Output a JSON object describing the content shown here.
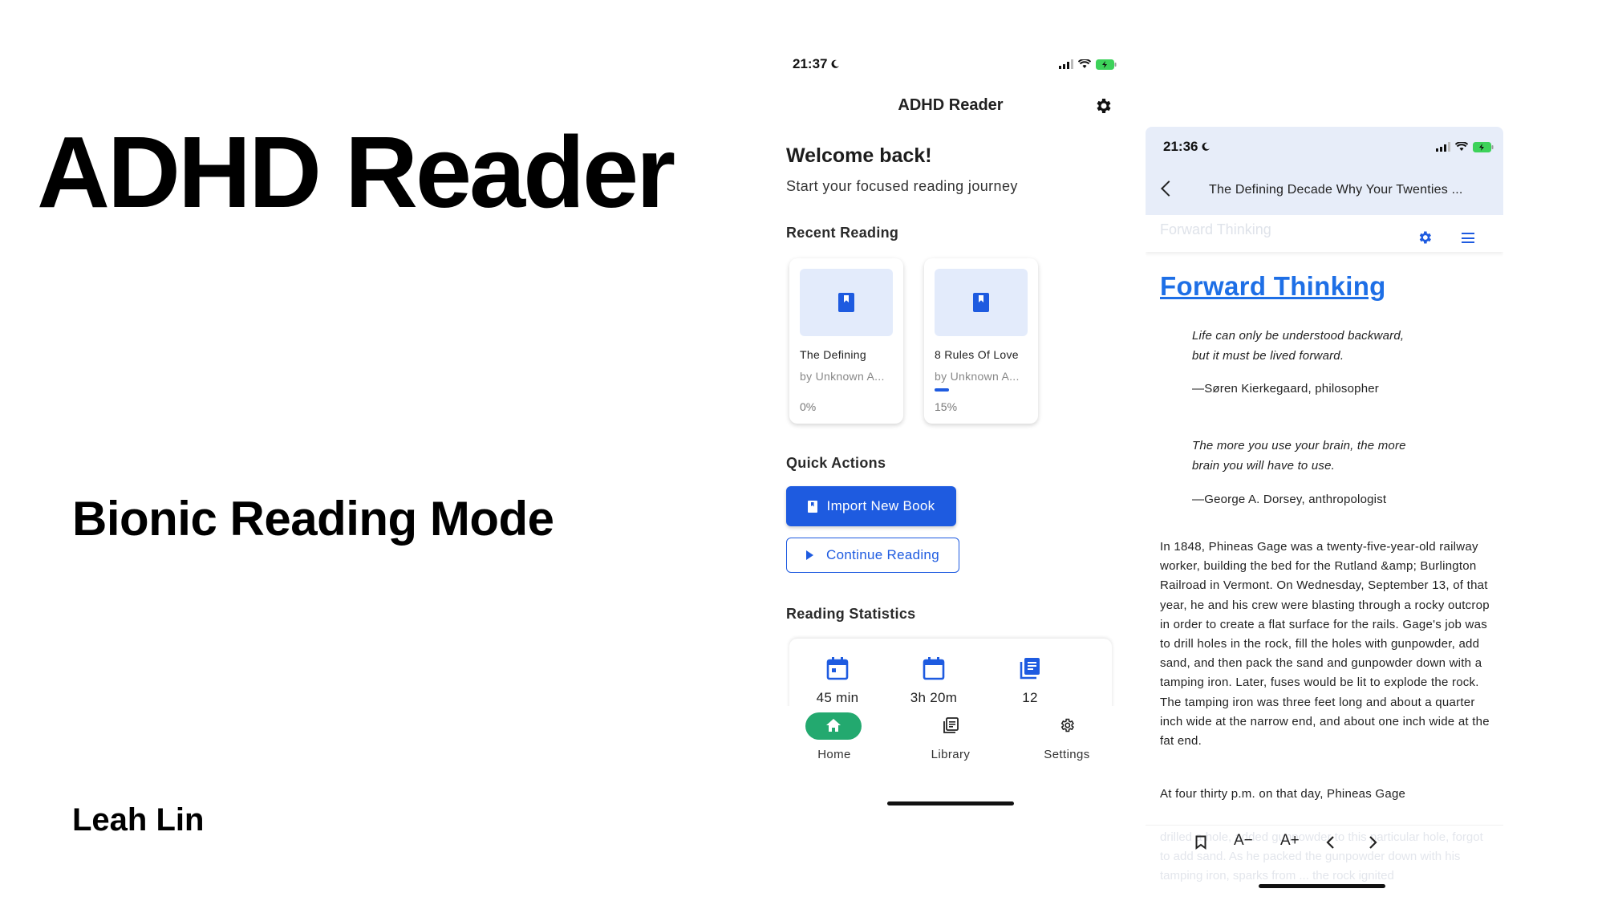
{
  "slide": {
    "title": "ADHD Reader",
    "subtitle": "Bionic Reading Mode",
    "author": "Leah Lin"
  },
  "phone_home": {
    "status_time": "21:37",
    "app_title": "ADHD Reader",
    "welcome_title": "Welcome back!",
    "welcome_subtitle": "Start your focused reading journey",
    "recent_label": "Recent Reading",
    "books": [
      {
        "title": "The Defining",
        "author": "by Unknown A...",
        "progress": "0%"
      },
      {
        "title": "8 Rules Of Love",
        "author": "by Unknown A...",
        "progress": "15%"
      }
    ],
    "quick_actions_label": "Quick Actions",
    "import_button": "Import New Book",
    "continue_button": "Continue Reading",
    "stats_label": "Reading Statistics",
    "stats": [
      {
        "value": "45 min",
        "icon": "calendar-icon"
      },
      {
        "value": "3h 20m",
        "icon": "calendar-icon"
      },
      {
        "value": "12",
        "icon": "library-icon"
      }
    ],
    "nav": [
      {
        "label": "Home",
        "icon": "home-icon",
        "active": true
      },
      {
        "label": "Library",
        "icon": "library-icon",
        "active": false
      },
      {
        "label": "Settings",
        "icon": "gear-icon",
        "active": false
      }
    ]
  },
  "phone_reader": {
    "status_time": "21:36",
    "book_title": "The Defining Decade Why Your Twenties ...",
    "ghost_chapter": "Forward Thinking",
    "chapter_title": "Forward Thinking",
    "quote1_line1": "Life can only be understood backward,",
    "quote1_line2": "but it must be lived forward.",
    "quote1_attrib": "—Søren Kierkegaard, philosopher",
    "quote2_line1": "The more you use your brain, the more",
    "quote2_line2": "brain you will have to use.",
    "quote2_attrib": "—George A. Dorsey, anthropologist",
    "para1": "In 1848, Phineas Gage was a twenty-five-year-old railway worker, building the bed for the Rutland &amp; Burlington Railroad in Vermont. On Wednesday, September 13, of that year, he and his crew were blasting through a rocky outcrop in order to create a flat surface for the rails. Gage's job was to drill holes in the rock, fill the holes with gunpowder, add sand, and then pack the sand and gunpowder down with a tamping iron. Later, fuses would be lit to explode the rock. The tamping iron was three feet long and about a quarter inch wide at the narrow end, and about one inch wide at the fat end.",
    "para2_visible": "At four thirty p.m. on that day, Phineas Gage",
    "para2_faded": "drilled a hole, added gunpowder to this particular hole, forgot to add sand. As he packed the gunpowder down with his tamping iron, sparks from ... the rock ignited",
    "toolbar": {
      "font_smaller": "A−",
      "font_larger": "A+"
    }
  },
  "colors": {
    "accent_blue": "#1e5be0",
    "link_blue": "#1e6fe6",
    "nav_active_green": "#23a96f",
    "header_tint": "#e7edf9"
  }
}
